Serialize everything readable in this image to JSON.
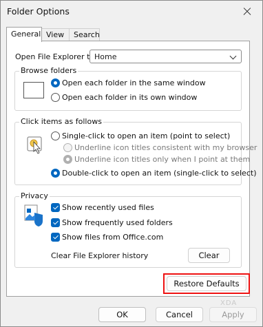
{
  "window": {
    "title": "Folder Options"
  },
  "tabs": [
    {
      "label": "General",
      "active": true
    },
    {
      "label": "View"
    },
    {
      "label": "Search"
    }
  ],
  "open_explorer": {
    "label": "Open File Explorer to:",
    "selected": "Home"
  },
  "browse_folders": {
    "title": "Browse folders",
    "options": [
      {
        "label": "Open each folder in the same window",
        "checked": true
      },
      {
        "label": "Open each folder in its own window",
        "checked": false
      }
    ]
  },
  "click_items": {
    "title": "Click items as follows",
    "options": [
      {
        "label": "Single-click to open an item (point to select)",
        "checked": false
      },
      {
        "label": "Underline icon titles consistent with my browser",
        "checked": false,
        "disabled": true
      },
      {
        "label": "Underline icon titles only when I point at them",
        "checked": true,
        "disabled": true
      },
      {
        "label": "Double-click to open an item (single-click to select)",
        "checked": true
      }
    ]
  },
  "privacy": {
    "title": "Privacy",
    "checkboxes": [
      {
        "label": "Show recently used files",
        "checked": true
      },
      {
        "label": "Show frequently used folders",
        "checked": true
      },
      {
        "label": "Show files from Office.com",
        "checked": true
      }
    ],
    "clear_history_label": "Clear File Explorer history",
    "clear_button": "Clear"
  },
  "restore_defaults": "Restore Defaults",
  "footer": {
    "ok": "OK",
    "cancel": "Cancel",
    "apply": "Apply"
  },
  "watermark": "XDA",
  "colors": {
    "accent": "#0067c0",
    "highlight_box": "#ee1111"
  },
  "icons": [
    "close-icon",
    "folder-window-icon",
    "click-cursor-icon",
    "privacy-icon",
    "chevron-down-icon"
  ]
}
